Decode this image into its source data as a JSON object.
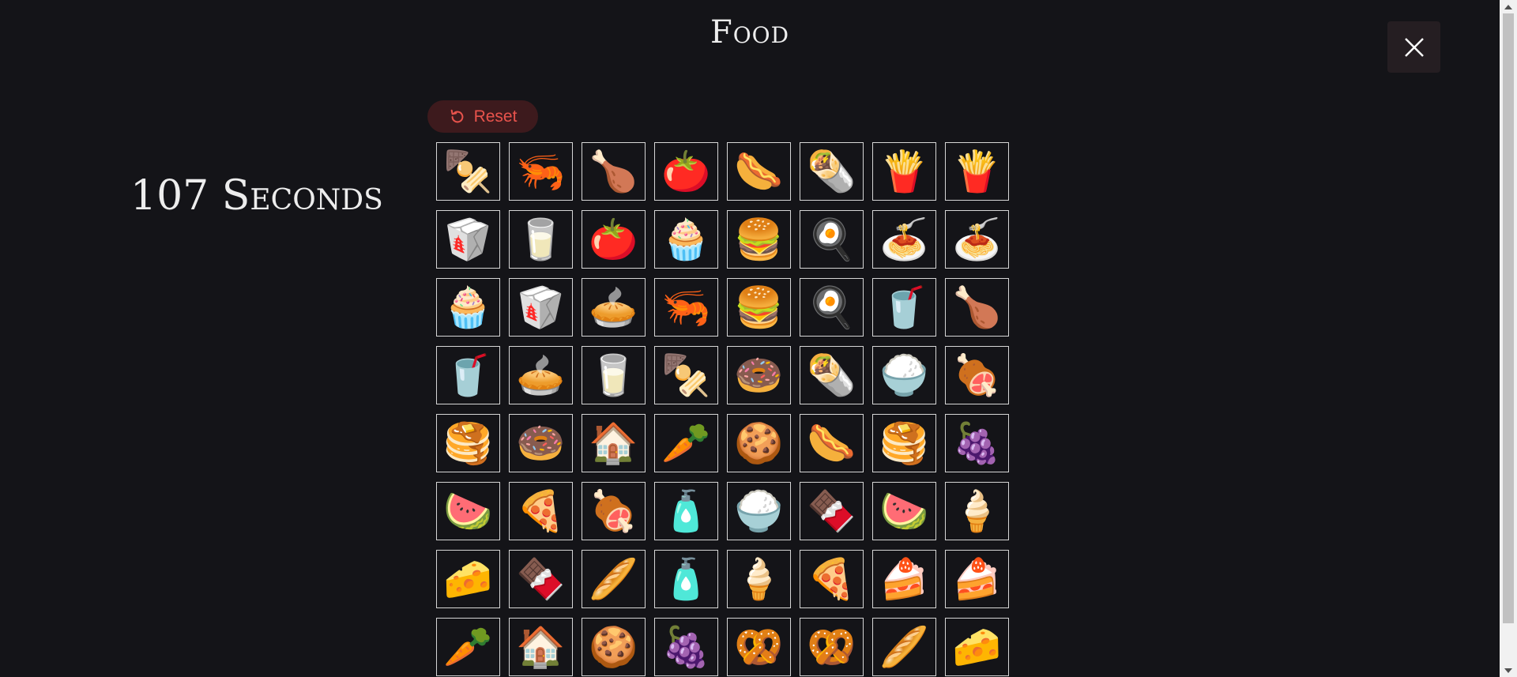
{
  "header": {
    "title": "Food"
  },
  "timer": {
    "text": "107 Seconds"
  },
  "controls": {
    "reset_label": "Reset"
  },
  "cards": [
    {
      "icon": "skewer",
      "glyph": "🍢"
    },
    {
      "icon": "shrimp",
      "glyph": "🦐"
    },
    {
      "icon": "poultry-leg",
      "glyph": "🍗"
    },
    {
      "icon": "tomato",
      "glyph": "🍅"
    },
    {
      "icon": "hot-dog",
      "glyph": "🌭"
    },
    {
      "icon": "burrito",
      "glyph": "🌯"
    },
    {
      "icon": "french-fries",
      "glyph": "🍟"
    },
    {
      "icon": "french-fries",
      "glyph": "🍟"
    },
    {
      "icon": "takeout-box",
      "glyph": "🥡"
    },
    {
      "icon": "milk-bottle",
      "glyph": "🥛"
    },
    {
      "icon": "tomato",
      "glyph": "🍅"
    },
    {
      "icon": "cupcake",
      "glyph": "🧁"
    },
    {
      "icon": "hamburger",
      "glyph": "🍔"
    },
    {
      "icon": "fried-egg",
      "glyph": "🍳"
    },
    {
      "icon": "noodles",
      "glyph": "🍝"
    },
    {
      "icon": "noodles",
      "glyph": "🍝"
    },
    {
      "icon": "cupcake",
      "glyph": "🧁"
    },
    {
      "icon": "takeout-box",
      "glyph": "🥡"
    },
    {
      "icon": "pie",
      "glyph": "🥧"
    },
    {
      "icon": "shrimp",
      "glyph": "🦐"
    },
    {
      "icon": "hamburger",
      "glyph": "🍔"
    },
    {
      "icon": "fried-egg",
      "glyph": "🍳"
    },
    {
      "icon": "cola-bottle",
      "glyph": "🥤"
    },
    {
      "icon": "poultry-leg",
      "glyph": "🍗"
    },
    {
      "icon": "cola-bottle",
      "glyph": "🥤"
    },
    {
      "icon": "pie",
      "glyph": "🥧"
    },
    {
      "icon": "milk-bottle",
      "glyph": "🥛"
    },
    {
      "icon": "skewer",
      "glyph": "🍢"
    },
    {
      "icon": "donut",
      "glyph": "🍩"
    },
    {
      "icon": "burrito",
      "glyph": "🌯"
    },
    {
      "icon": "rice-bowl",
      "glyph": "🍚"
    },
    {
      "icon": "roast-chicken",
      "glyph": "🍖"
    },
    {
      "icon": "pancakes",
      "glyph": "🥞"
    },
    {
      "icon": "donut",
      "glyph": "🍩"
    },
    {
      "icon": "gingerbread-house",
      "glyph": "🏠"
    },
    {
      "icon": "carrot",
      "glyph": "🥕"
    },
    {
      "icon": "cookie",
      "glyph": "🍪"
    },
    {
      "icon": "hot-dog",
      "glyph": "🌭"
    },
    {
      "icon": "pancakes",
      "glyph": "🥞"
    },
    {
      "icon": "grapes",
      "glyph": "🍇"
    },
    {
      "icon": "watermelon",
      "glyph": "🍉"
    },
    {
      "icon": "pizza",
      "glyph": "🍕"
    },
    {
      "icon": "roast-chicken",
      "glyph": "🍖"
    },
    {
      "icon": "condiments",
      "glyph": "🧴"
    },
    {
      "icon": "rice-bowl",
      "glyph": "🍚"
    },
    {
      "icon": "chocolate-bar",
      "glyph": "🍫"
    },
    {
      "icon": "watermelon",
      "glyph": "🍉"
    },
    {
      "icon": "ice-cream",
      "glyph": "🍦"
    },
    {
      "icon": "cheese",
      "glyph": "🧀"
    },
    {
      "icon": "chocolate-bar",
      "glyph": "🍫"
    },
    {
      "icon": "baguette",
      "glyph": "🥖"
    },
    {
      "icon": "condiments",
      "glyph": "🧴"
    },
    {
      "icon": "ice-cream",
      "glyph": "🍦"
    },
    {
      "icon": "pizza",
      "glyph": "🍕"
    },
    {
      "icon": "cheesecake",
      "glyph": "🍰"
    },
    {
      "icon": "cheesecake",
      "glyph": "🍰"
    },
    {
      "icon": "carrot",
      "glyph": "🥕"
    },
    {
      "icon": "gingerbread-house",
      "glyph": "🏠"
    },
    {
      "icon": "cookie",
      "glyph": "🍪"
    },
    {
      "icon": "grapes",
      "glyph": "🍇"
    },
    {
      "icon": "pretzel",
      "glyph": "🥨"
    },
    {
      "icon": "pretzel",
      "glyph": "🥨"
    },
    {
      "icon": "baguette",
      "glyph": "🥖"
    },
    {
      "icon": "cheese",
      "glyph": "🧀"
    }
  ],
  "colors": {
    "background": "#141418",
    "accent": "#e8534c",
    "reset_bg": "#3d1a1d",
    "close_bg": "#251e22",
    "card_border": "#d6d6d6",
    "text": "#ededed"
  }
}
